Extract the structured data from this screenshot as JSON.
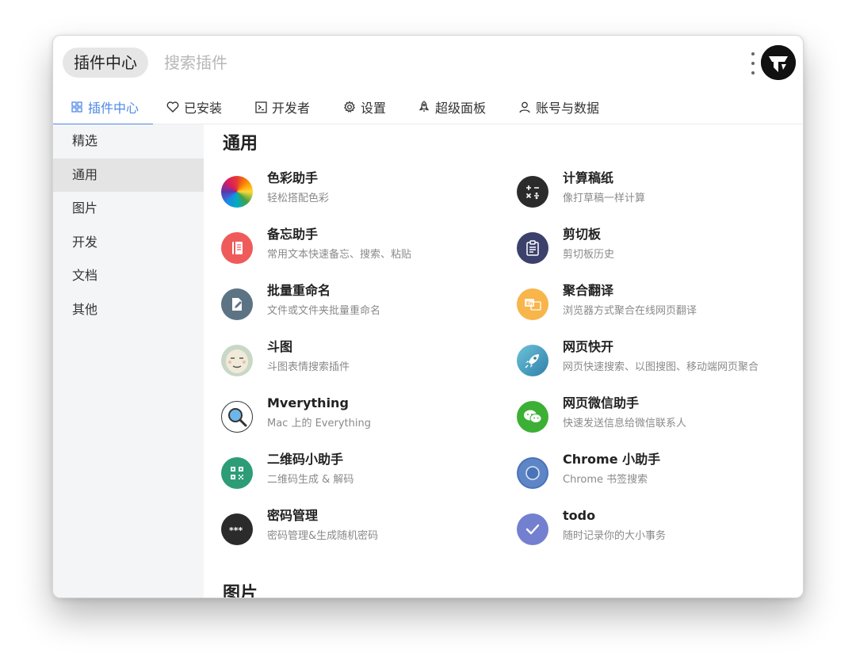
{
  "search": {
    "tag": "插件中心",
    "placeholder": "搜索插件"
  },
  "tabs": [
    {
      "label": "插件中心",
      "icon": "grid-icon",
      "active": true
    },
    {
      "label": "已安装",
      "icon": "heart-icon"
    },
    {
      "label": "开发者",
      "icon": "terminal-icon"
    },
    {
      "label": "设置",
      "icon": "gear-icon"
    },
    {
      "label": "超级面板",
      "icon": "rocket-icon"
    },
    {
      "label": "账号与数据",
      "icon": "user-icon"
    }
  ],
  "sidebar": {
    "items": [
      {
        "label": "精选"
      },
      {
        "label": "通用",
        "active": true
      },
      {
        "label": "图片"
      },
      {
        "label": "开发"
      },
      {
        "label": "文档"
      },
      {
        "label": "其他"
      }
    ]
  },
  "sections": [
    {
      "title": "通用",
      "plugins": [
        {
          "name": "色彩助手",
          "desc": "轻松搭配色彩",
          "icon": "color-wheel-icon"
        },
        {
          "name": "计算稿纸",
          "desc": "像打草稿一样计算",
          "icon": "calculator-icon",
          "color": "#2b2b2b"
        },
        {
          "name": "备忘助手",
          "desc": "常用文本快速备忘、搜索、粘贴",
          "icon": "notebook-icon",
          "color": "#ef5b5b"
        },
        {
          "name": "剪切板",
          "desc": "剪切板历史",
          "icon": "clipboard-icon",
          "color": "#3c416b"
        },
        {
          "name": "批量重命名",
          "desc": "文件或文件夹批量重命名",
          "icon": "rename-icon",
          "color": "#5c7384"
        },
        {
          "name": "聚合翻译",
          "desc": "浏览器方式聚合在线网页翻译",
          "icon": "translate-icon",
          "color": "#f7b54a"
        },
        {
          "name": "斗图",
          "desc": "斗图表情搜索插件",
          "icon": "meme-face-icon",
          "color": "#c9d8c6"
        },
        {
          "name": "网页快开",
          "desc": "网页快速搜索、以图搜图、移动端网页聚合",
          "icon": "rocket-launch-icon",
          "color": "#4aa6c4"
        },
        {
          "name": "Mverything",
          "desc": "Mac 上的 Everything",
          "icon": "magnifier-icon",
          "color": "#ffffff"
        },
        {
          "name": "网页微信助手",
          "desc": "快速发送信息给微信联系人",
          "icon": "wechat-icon",
          "color": "#3cb034"
        },
        {
          "name": "二维码小助手",
          "desc": "二维码生成 & 解码",
          "icon": "qrcode-icon",
          "color": "#2c9d77"
        },
        {
          "name": "Chrome 小助手",
          "desc": "Chrome 书签搜索",
          "icon": "chrome-icon",
          "color": "#4a74b8"
        },
        {
          "name": "密码管理",
          "desc": "密码管理&生成随机密码",
          "icon": "password-icon",
          "color": "#2b2b2b"
        },
        {
          "name": "todo",
          "desc": "随时记录你的大小事务",
          "icon": "check-icon",
          "color": "#7380d0"
        }
      ]
    },
    {
      "title": "图片"
    }
  ],
  "colors": {
    "accent": "#4e88e6"
  }
}
